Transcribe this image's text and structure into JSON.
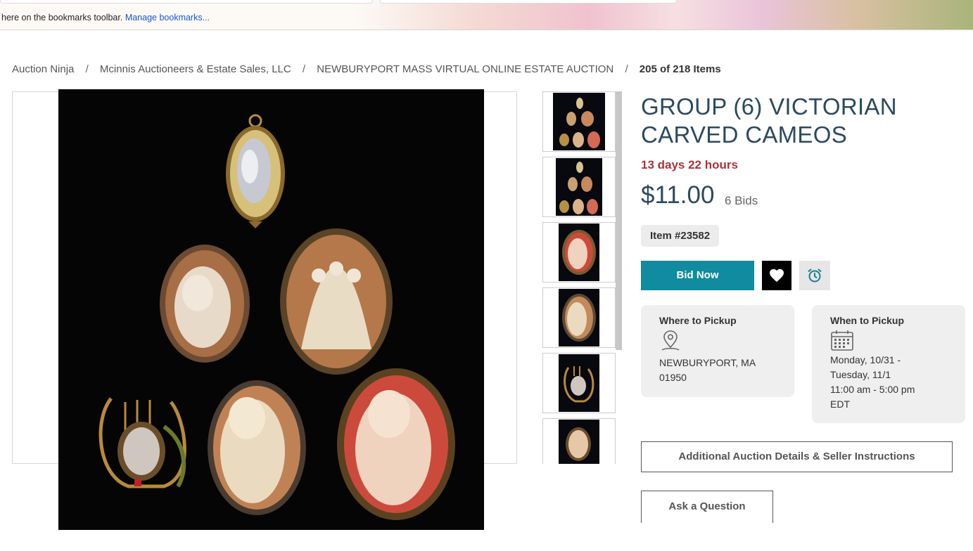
{
  "bookmarks_bar": {
    "message": "here on the bookmarks toolbar.",
    "link": "Manage bookmarks..."
  },
  "breadcrumb": {
    "items": [
      "Auction Ninja",
      "Mcinnis Auctioneers & Estate Sales, LLC",
      "NEWBURYPORT MASS VIRTUAL ONLINE ESTATE AUCTION"
    ],
    "current": "205 of 218 Items",
    "separator": "/"
  },
  "item": {
    "title": "GROUP (6) VICTORIAN CARVED CAMEOS",
    "time_left": "13 days 22 hours",
    "price": "$11.00",
    "bids": "6 Bids",
    "item_number": "Item #23582"
  },
  "actions": {
    "bid_label": "Bid Now",
    "watch_icon": "heart-icon",
    "reminder_icon": "alarm-clock-icon"
  },
  "pickup_location": {
    "heading": "Where to Pickup",
    "icon": "map-pin-icon",
    "line1": "NEWBURYPORT, MA",
    "line2": "01950"
  },
  "pickup_time": {
    "heading": "When to Pickup",
    "icon": "calendar-icon",
    "line1": "Monday, 10/31 -",
    "line2": "Tuesday, 11/1",
    "line3": "11:00 am - 5:00 pm",
    "line4": "EDT"
  },
  "buttons": {
    "details": "Additional Auction Details & Seller Instructions",
    "question": "Ask a Question"
  },
  "colors": {
    "accent": "#108b9f",
    "title": "#2c4a5e",
    "time_left": "#b0303a",
    "card_bg": "#efefef"
  }
}
